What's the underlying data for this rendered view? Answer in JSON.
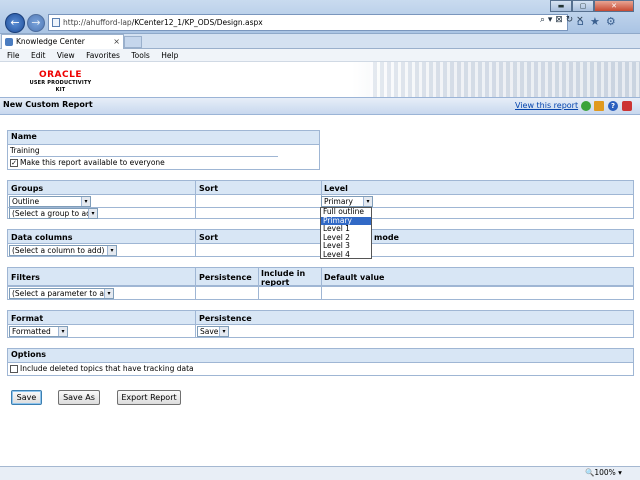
{
  "browser": {
    "url_host": "http://ahufford-lap",
    "url_path": "/KCenter12_1/KP_ODS/Design.aspx",
    "tab_title": "Knowledge Center",
    "tab_close": "×",
    "menu": [
      "File",
      "Edit",
      "View",
      "Favorites",
      "Tools",
      "Help"
    ],
    "addr_tools": "⌕ ▾ ⊠ ↻ ×",
    "right_icons": "⌂★⚙",
    "window_buttons": {
      "min": "▬",
      "max": "▢",
      "close": "✕"
    },
    "zoom": "🔍100% ▾"
  },
  "header": {
    "logo_line1": "ORACLE",
    "logo_line2": "USER PRODUCTIVITY KIT",
    "page_title": "New Custom Report",
    "view_link": "View this report",
    "help_glyph": "?"
  },
  "name_section": {
    "title": "Name",
    "value": "Training",
    "share_checkbox_label": "Make this report available to everyone",
    "share_checked": "✓"
  },
  "groups_section": {
    "title": "Groups",
    "sort_header": "Sort",
    "level_header": "Level",
    "group_value": "Outline",
    "add_group_placeholder": "(Select a group to add)",
    "level_value": "Primary",
    "level_options": [
      "Full outline",
      "Primary",
      "Level 1",
      "Level 2",
      "Level 3",
      "Level 4"
    ]
  },
  "columns_section": {
    "title": "Data columns",
    "sort_header": "Sort",
    "mode_header": "mode",
    "add_column_placeholder": "(Select a column to add)"
  },
  "filters_section": {
    "title": "Filters",
    "persistence_header": "Persistence",
    "include_header": "Include in report",
    "default_header": "Default value",
    "add_param_placeholder": "(Select a parameter to add)"
  },
  "format_section": {
    "title": "Format",
    "persistence_header": "Persistence",
    "format_value": "Formatted",
    "persistence_value": "Save"
  },
  "options_section": {
    "title": "Options",
    "deleted_topics_label": "Include deleted topics that have tracking data"
  },
  "buttons": {
    "save": "Save",
    "save_as": "Save As",
    "export": "Export Report"
  },
  "icons": {
    "dropdown_arrow": "▾",
    "back": "←",
    "forward": "→"
  }
}
